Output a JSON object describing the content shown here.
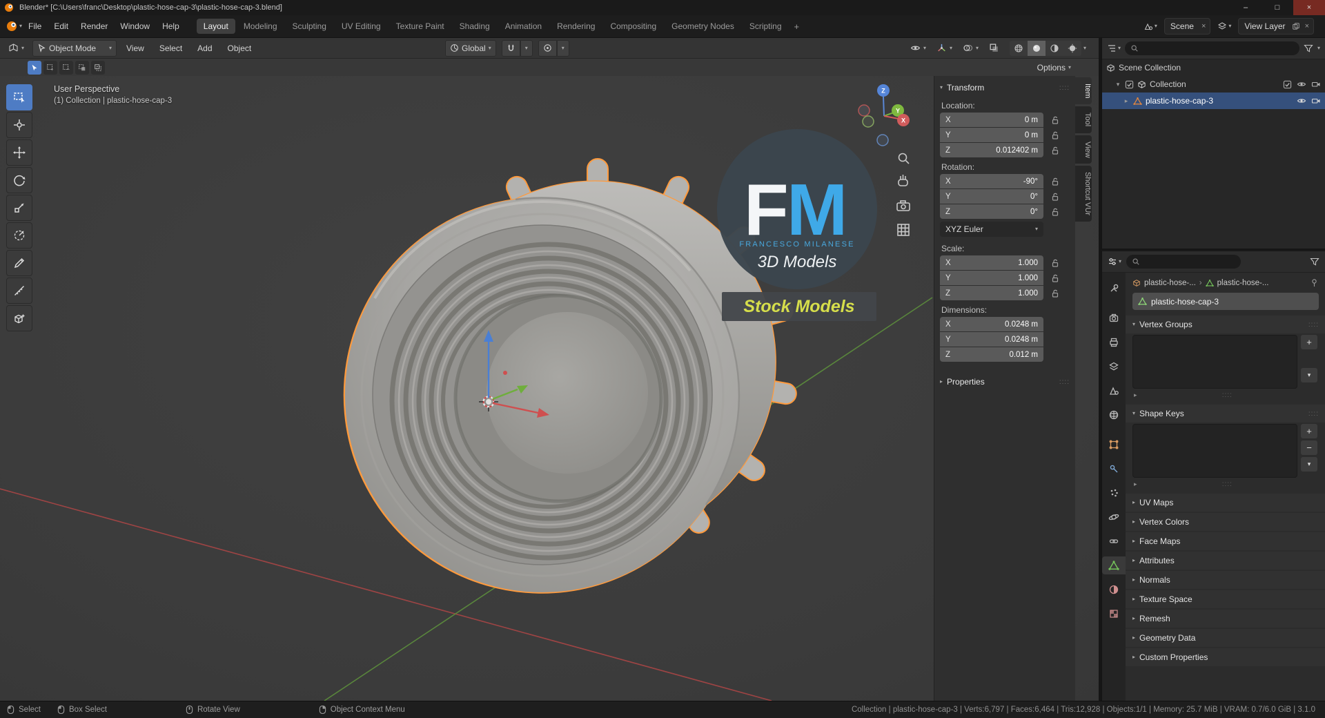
{
  "window": {
    "title": "Blender* [C:\\Users\\franc\\Desktop\\plastic-hose-cap-3\\plastic-hose-cap-3.blend]"
  },
  "icons": {
    "minimize": "–",
    "maximize": "□",
    "close": "×",
    "x": "×",
    "plus": "+",
    "minus": "−",
    "caret_down": "▾",
    "caret_right": "▸",
    "separator": "›",
    "grip": "::::"
  },
  "topbar": {
    "menus": [
      "File",
      "Edit",
      "Render",
      "Window",
      "Help"
    ],
    "workspaces": [
      "Layout",
      "Modeling",
      "Sculpting",
      "UV Editing",
      "Texture Paint",
      "Shading",
      "Animation",
      "Rendering",
      "Compositing",
      "Geometry Nodes",
      "Scripting"
    ],
    "scene": "Scene",
    "view_layer": "View Layer"
  },
  "header": {
    "mode": "Object Mode",
    "menus": [
      "View",
      "Select",
      "Add",
      "Object"
    ],
    "orientation": "Global",
    "options": "Options"
  },
  "viewport": {
    "label_perspective": "User Perspective",
    "label_collection": "(1) Collection | plastic-hose-cap-3"
  },
  "watermark": {
    "f": "F",
    "m": "M",
    "name": "FRANCESCO MILANESE",
    "line2": "3D Models",
    "badge": "Stock Models"
  },
  "ntabs": [
    "Item",
    "Tool",
    "View",
    "Shortcut VUr"
  ],
  "transform": {
    "title": "Transform",
    "axes": [
      "X",
      "Y",
      "Z"
    ],
    "location_label": "Location:",
    "location": {
      "x": "0 m",
      "y": "0 m",
      "z": "0.012402 m"
    },
    "rotation_label": "Rotation:",
    "rotation": {
      "x": "-90°",
      "y": "0°",
      "z": "0°"
    },
    "euler_mode": "XYZ Euler",
    "scale_label": "Scale:",
    "scale": {
      "x": "1.000",
      "y": "1.000",
      "z": "1.000"
    },
    "dimensions_label": "Dimensions:",
    "dimensions": {
      "x": "0.0248 m",
      "y": "0.0248 m",
      "z": "0.012 m"
    },
    "properties_label": "Properties"
  },
  "outliner": {
    "rows": [
      {
        "label": "Scene Collection"
      },
      {
        "label": "Collection"
      },
      {
        "label": "plastic-hose-cap-3"
      }
    ]
  },
  "properties": {
    "breadcrumb_object": "plastic-hose-...",
    "breadcrumb_data": "plastic-hose-...",
    "name": "plastic-hose-cap-3",
    "panels_expanded": [
      "Vertex Groups",
      "Shape Keys"
    ],
    "panels_collapsed": [
      "UV Maps",
      "Vertex Colors",
      "Face Maps",
      "Attributes",
      "Normals",
      "Texture Space",
      "Remesh",
      "Geometry Data",
      "Custom Properties"
    ]
  },
  "statusbar": {
    "hints": [
      "Select",
      "Box Select",
      "Rotate View",
      "Object Context Menu"
    ],
    "stats": "Collection | plastic-hose-cap-3 | Verts:6,797 | Faces:6,464 | Tris:12,928 | Objects:1/1 | Memory: 25.7 MiB | VRAM: 0.7/6.0 GiB | 3.1.0"
  },
  "colors": {
    "selection_outline": "#ff9a3c",
    "active_tool_blue": "#4e7cc4",
    "axis_x": "#d65a5a",
    "axis_y": "#76b23f",
    "axis_z": "#5a87d6",
    "watermark_blue": "#3fa9e8",
    "watermark_yellow": "#d6de4b"
  }
}
